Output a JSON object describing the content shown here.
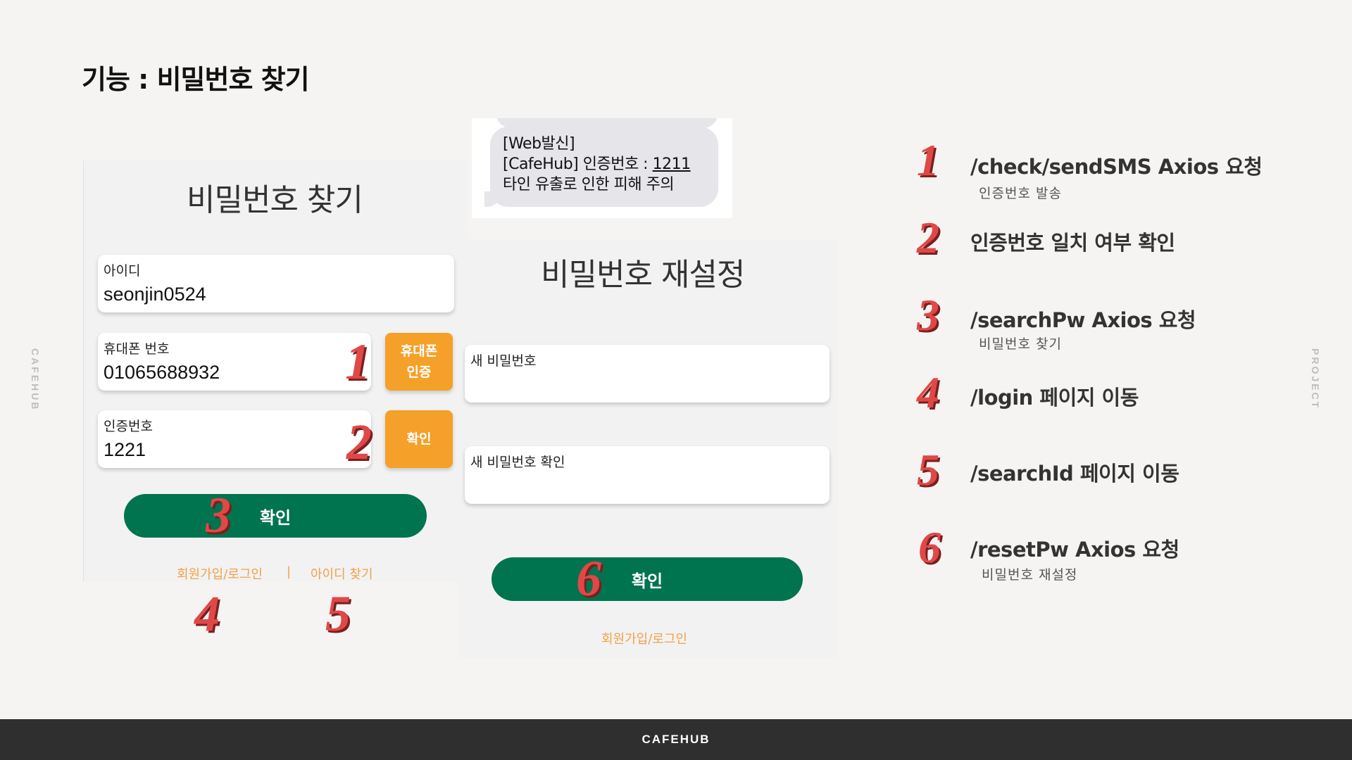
{
  "slide": {
    "title": "기능 : 비밀번호 찾기",
    "side_left": "CAFEHUB",
    "side_right": "PROJECT",
    "footer": "CAFEHUB"
  },
  "find_pw": {
    "heading": "비밀번호 찾기",
    "id_field": {
      "label": "아이디",
      "value": "seonjin0524"
    },
    "phone_field": {
      "label": "휴대폰 번호",
      "value": "01065688932"
    },
    "phone_verify_button": [
      "휴대폰",
      "인증"
    ],
    "code_field": {
      "label": "인증번호",
      "value": "1221"
    },
    "code_confirm_button": "확인",
    "submit_button": "확인",
    "link_signup": "회원가입/로그인",
    "separator": "|",
    "link_find_id": "아이디 찾기"
  },
  "sms": {
    "line1": "[Web발신]",
    "line2_prefix": "[CafeHub] 인증번호 : ",
    "code": "1211",
    "line3": "타인 유출로 인한 피해 주의"
  },
  "reset_pw": {
    "heading": "비밀번호 재설정",
    "new_pw_label": "새 비밀번호",
    "new_pw_confirm_label": "새 비밀번호 확인",
    "submit_button": "확인",
    "link_signup": "회원가입/로그인"
  },
  "markers": [
    "1",
    "2",
    "3",
    "4",
    "5",
    "6"
  ],
  "steps": [
    {
      "num": "1",
      "title": "/check/sendSMS Axios 요청",
      "sub": "인증번호 발송"
    },
    {
      "num": "2",
      "title": "인증번호 일치 여부 확인",
      "sub": ""
    },
    {
      "num": "3",
      "title": "/searchPw Axios 요청",
      "sub": "비밀번호 찾기"
    },
    {
      "num": "4",
      "title": "/login 페이지 이동",
      "sub": ""
    },
    {
      "num": "5",
      "title": "/searchId 페이지 이동",
      "sub": ""
    },
    {
      "num": "6",
      "title": "/resetPw Axios 요청",
      "sub": "비밀번호 재설정"
    }
  ],
  "colors": {
    "background": "#f5f4f2",
    "accent_orange": "#f5a028",
    "accent_green": "#00734f",
    "marker_red": "#e04848",
    "footer": "#2f2f2f"
  }
}
